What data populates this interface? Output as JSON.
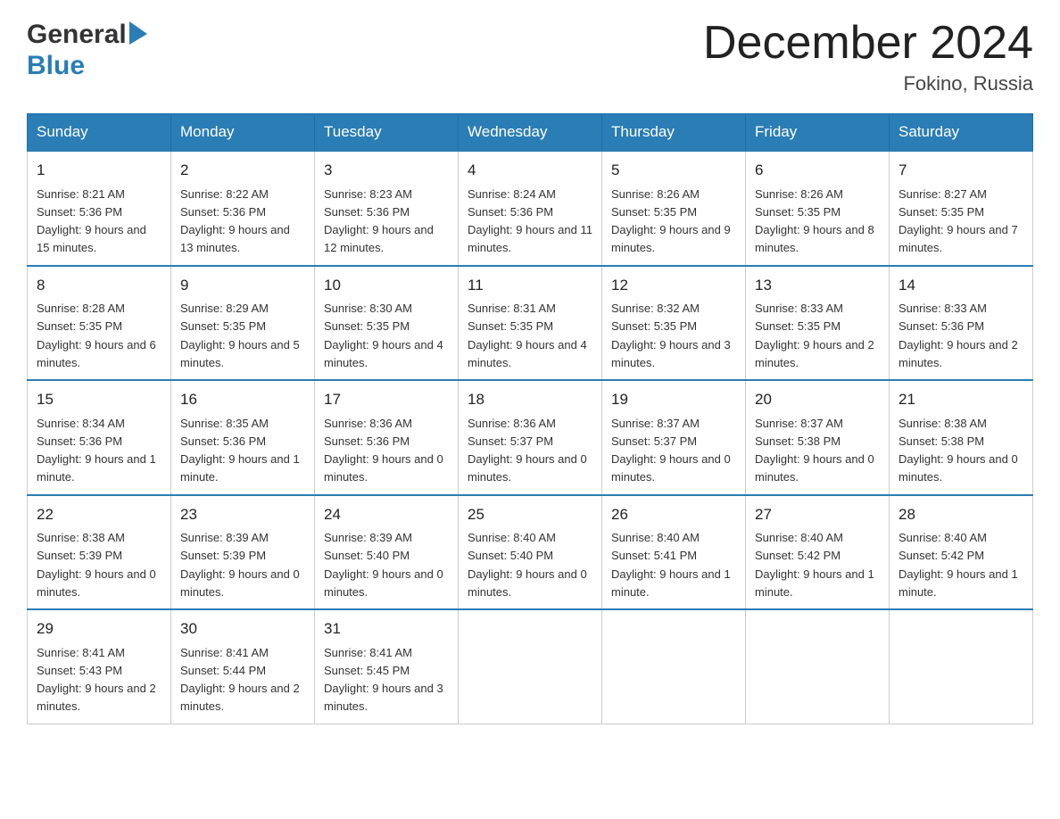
{
  "header": {
    "logo_general": "General",
    "logo_blue": "Blue",
    "month_title": "December 2024",
    "location": "Fokino, Russia"
  },
  "calendar": {
    "days": [
      "Sunday",
      "Monday",
      "Tuesday",
      "Wednesday",
      "Thursday",
      "Friday",
      "Saturday"
    ],
    "weeks": [
      [
        {
          "day": "1",
          "sunrise": "8:21 AM",
          "sunset": "5:36 PM",
          "daylight": "9 hours and 15 minutes."
        },
        {
          "day": "2",
          "sunrise": "8:22 AM",
          "sunset": "5:36 PM",
          "daylight": "9 hours and 13 minutes."
        },
        {
          "day": "3",
          "sunrise": "8:23 AM",
          "sunset": "5:36 PM",
          "daylight": "9 hours and 12 minutes."
        },
        {
          "day": "4",
          "sunrise": "8:24 AM",
          "sunset": "5:36 PM",
          "daylight": "9 hours and 11 minutes."
        },
        {
          "day": "5",
          "sunrise": "8:26 AM",
          "sunset": "5:35 PM",
          "daylight": "9 hours and 9 minutes."
        },
        {
          "day": "6",
          "sunrise": "8:26 AM",
          "sunset": "5:35 PM",
          "daylight": "9 hours and 8 minutes."
        },
        {
          "day": "7",
          "sunrise": "8:27 AM",
          "sunset": "5:35 PM",
          "daylight": "9 hours and 7 minutes."
        }
      ],
      [
        {
          "day": "8",
          "sunrise": "8:28 AM",
          "sunset": "5:35 PM",
          "daylight": "9 hours and 6 minutes."
        },
        {
          "day": "9",
          "sunrise": "8:29 AM",
          "sunset": "5:35 PM",
          "daylight": "9 hours and 5 minutes."
        },
        {
          "day": "10",
          "sunrise": "8:30 AM",
          "sunset": "5:35 PM",
          "daylight": "9 hours and 4 minutes."
        },
        {
          "day": "11",
          "sunrise": "8:31 AM",
          "sunset": "5:35 PM",
          "daylight": "9 hours and 4 minutes."
        },
        {
          "day": "12",
          "sunrise": "8:32 AM",
          "sunset": "5:35 PM",
          "daylight": "9 hours and 3 minutes."
        },
        {
          "day": "13",
          "sunrise": "8:33 AM",
          "sunset": "5:35 PM",
          "daylight": "9 hours and 2 minutes."
        },
        {
          "day": "14",
          "sunrise": "8:33 AM",
          "sunset": "5:36 PM",
          "daylight": "9 hours and 2 minutes."
        }
      ],
      [
        {
          "day": "15",
          "sunrise": "8:34 AM",
          "sunset": "5:36 PM",
          "daylight": "9 hours and 1 minute."
        },
        {
          "day": "16",
          "sunrise": "8:35 AM",
          "sunset": "5:36 PM",
          "daylight": "9 hours and 1 minute."
        },
        {
          "day": "17",
          "sunrise": "8:36 AM",
          "sunset": "5:36 PM",
          "daylight": "9 hours and 0 minutes."
        },
        {
          "day": "18",
          "sunrise": "8:36 AM",
          "sunset": "5:37 PM",
          "daylight": "9 hours and 0 minutes."
        },
        {
          "day": "19",
          "sunrise": "8:37 AM",
          "sunset": "5:37 PM",
          "daylight": "9 hours and 0 minutes."
        },
        {
          "day": "20",
          "sunrise": "8:37 AM",
          "sunset": "5:38 PM",
          "daylight": "9 hours and 0 minutes."
        },
        {
          "day": "21",
          "sunrise": "8:38 AM",
          "sunset": "5:38 PM",
          "daylight": "9 hours and 0 minutes."
        }
      ],
      [
        {
          "day": "22",
          "sunrise": "8:38 AM",
          "sunset": "5:39 PM",
          "daylight": "9 hours and 0 minutes."
        },
        {
          "day": "23",
          "sunrise": "8:39 AM",
          "sunset": "5:39 PM",
          "daylight": "9 hours and 0 minutes."
        },
        {
          "day": "24",
          "sunrise": "8:39 AM",
          "sunset": "5:40 PM",
          "daylight": "9 hours and 0 minutes."
        },
        {
          "day": "25",
          "sunrise": "8:40 AM",
          "sunset": "5:40 PM",
          "daylight": "9 hours and 0 minutes."
        },
        {
          "day": "26",
          "sunrise": "8:40 AM",
          "sunset": "5:41 PM",
          "daylight": "9 hours and 1 minute."
        },
        {
          "day": "27",
          "sunrise": "8:40 AM",
          "sunset": "5:42 PM",
          "daylight": "9 hours and 1 minute."
        },
        {
          "day": "28",
          "sunrise": "8:40 AM",
          "sunset": "5:42 PM",
          "daylight": "9 hours and 1 minute."
        }
      ],
      [
        {
          "day": "29",
          "sunrise": "8:41 AM",
          "sunset": "5:43 PM",
          "daylight": "9 hours and 2 minutes."
        },
        {
          "day": "30",
          "sunrise": "8:41 AM",
          "sunset": "5:44 PM",
          "daylight": "9 hours and 2 minutes."
        },
        {
          "day": "31",
          "sunrise": "8:41 AM",
          "sunset": "5:45 PM",
          "daylight": "9 hours and 3 minutes."
        },
        null,
        null,
        null,
        null
      ]
    ]
  }
}
